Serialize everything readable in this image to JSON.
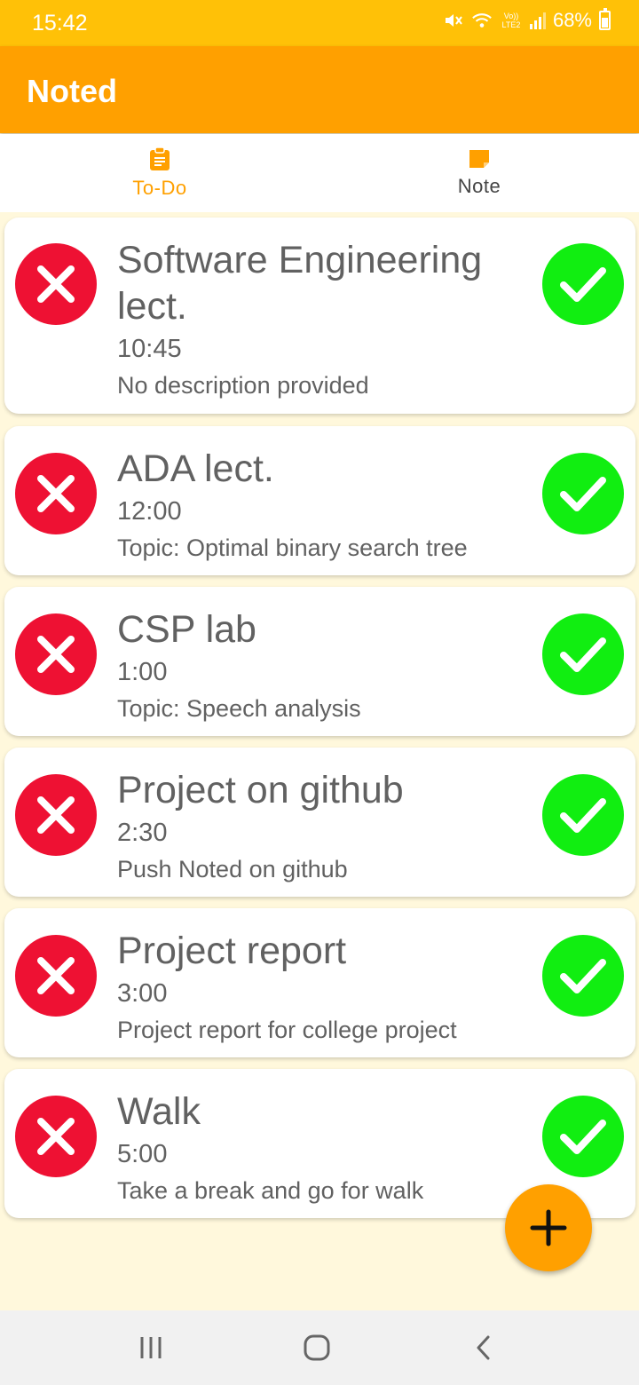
{
  "status_bar": {
    "time": "15:42",
    "network_label": "Vo)) LTE2",
    "battery": "68%",
    "icons": [
      "mute-icon",
      "wifi-icon",
      "signal-icon",
      "battery-icon"
    ]
  },
  "app": {
    "title": "Noted",
    "accent_color": "#ffa000"
  },
  "tabs": [
    {
      "label": "To-Do",
      "icon": "clipboard-icon",
      "selected": true
    },
    {
      "label": "Note",
      "icon": "note-icon",
      "selected": false
    }
  ],
  "todos": [
    {
      "title": "Software Engineering lect.",
      "time": "10:45",
      "description": "No description provided"
    },
    {
      "title": "ADA lect.",
      "time": "12:00",
      "description": "Topic: Optimal binary search tree"
    },
    {
      "title": "CSP lab",
      "time": "1:00",
      "description": "Topic: Speech analysis"
    },
    {
      "title": "Project on github",
      "time": "2:30",
      "description": "Push Noted on github"
    },
    {
      "title": "Project report",
      "time": "3:00",
      "description": "Project report for college project"
    },
    {
      "title": "Walk",
      "time": "5:00",
      "description": "Take a break and go for walk"
    }
  ],
  "colors": {
    "delete": "#ee1133",
    "done": "#11ee11",
    "background": "#fff8dc",
    "status_bar": "#ffc107"
  },
  "fab": {
    "icon": "plus-icon"
  },
  "nav_bar": {
    "buttons": [
      "recent-apps-icon",
      "home-icon",
      "back-icon"
    ]
  }
}
